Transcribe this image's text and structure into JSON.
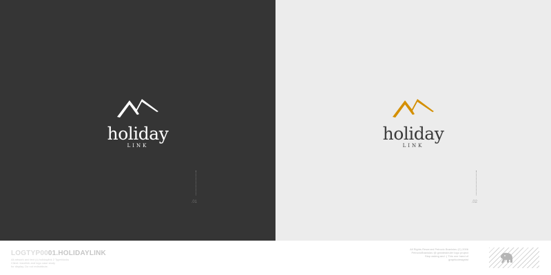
{
  "panels": [
    {
      "name": "dark",
      "background": "#353535",
      "mark_color": "#ffffff",
      "text_color": "#ffffff",
      "mark_icon": "mountain-peaks-icon",
      "wordmark": "holiday",
      "subline": "LINK",
      "marker_number": ".01",
      "marker_color": "#6e6e6e"
    },
    {
      "name": "light",
      "background": "#ececec",
      "mark_color": "#d48f00",
      "text_color": "#3a3a3a",
      "mark_icon": "mountain-peaks-icon",
      "wordmark": "holiday",
      "subline": "LINK",
      "marker_number": ".02",
      "marker_color": "#a9a9a9"
    }
  ],
  "footer": {
    "project_code": "LOGTYP00",
    "project_name": "01.HOLIDAYLINK",
    "description_lines": [
      "All artwork and text (c) holidaylink 2 Typeblocks",
      "Client: travelink and logo case study",
      "for display. Do not redistribute."
    ],
    "rights_lines": [
      "All Rights Reserved Petrovic Branislav (C) 2006",
      "PetrovicBranislav @ greatest/ruler logo project",
      "Stop asking and :) This one hand of",
      "graphicdesignist"
    ],
    "stamp_icon": "elephant-icon"
  }
}
